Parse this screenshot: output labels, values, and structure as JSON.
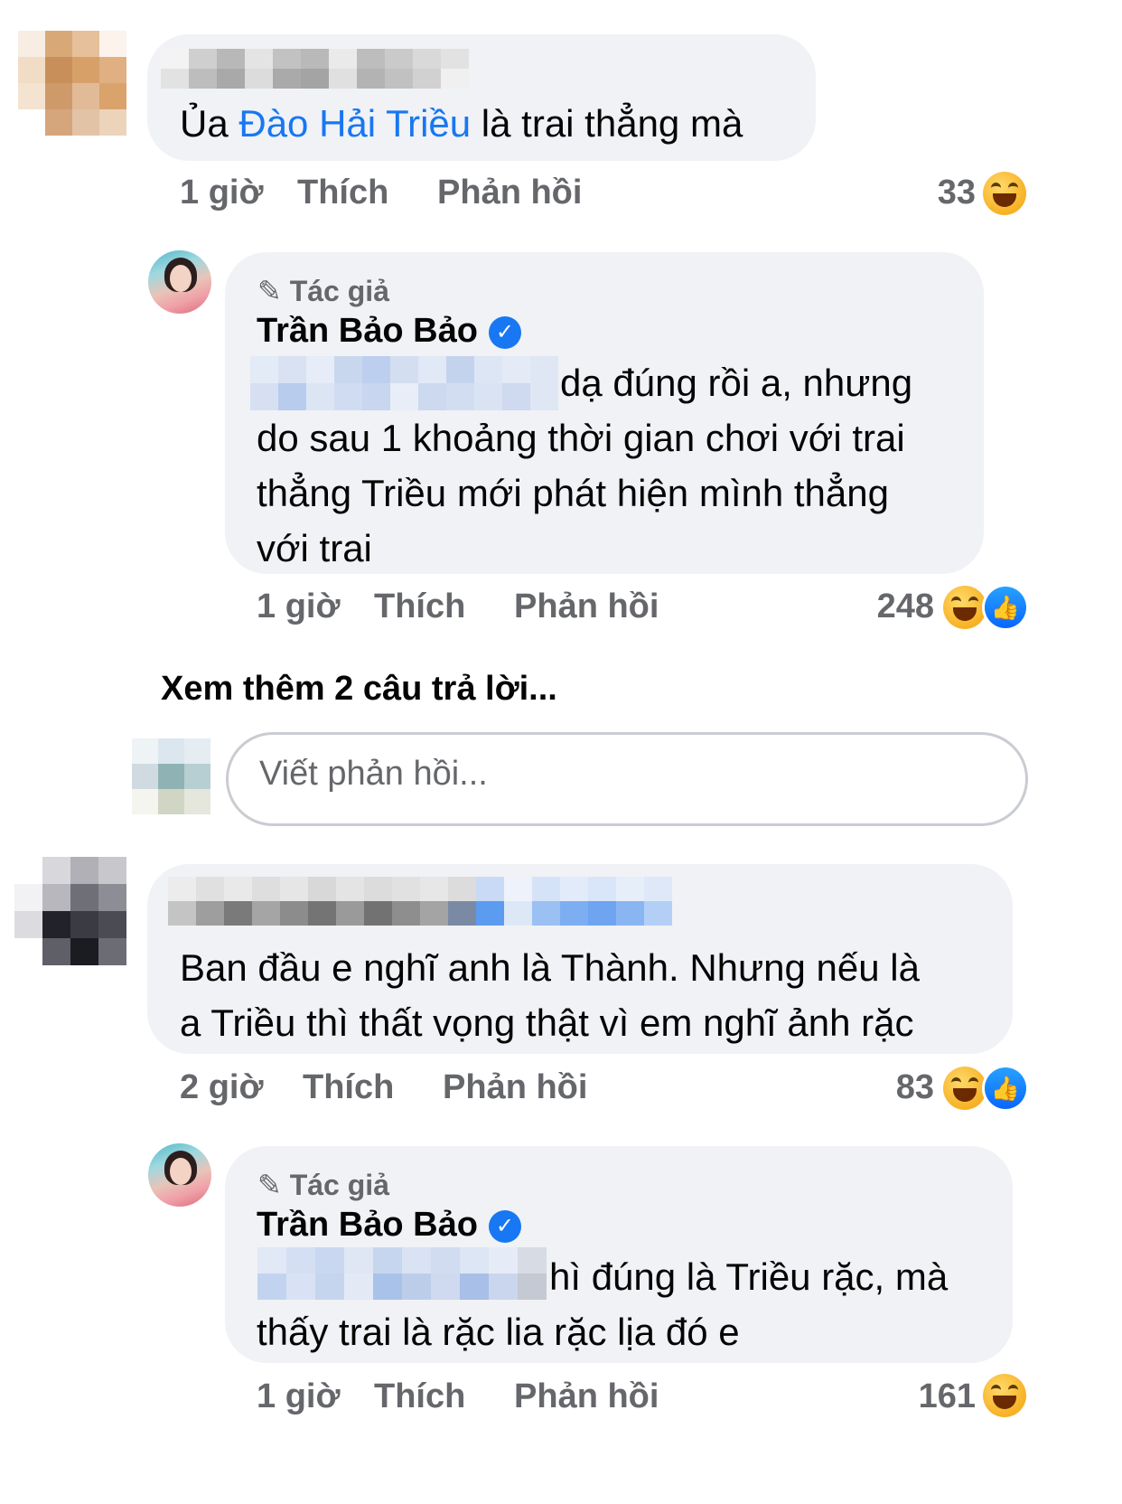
{
  "comments": [
    {
      "text_parts": [
        {
          "text": "Ủa ",
          "link": false
        },
        {
          "text": "Đào Hải Triều",
          "link": true
        },
        {
          "text": " là trai thẳng mà",
          "link": false
        }
      ],
      "time": "1 giờ",
      "like_label": "Thích",
      "reply_label": "Phản hồi",
      "reaction_count": "33",
      "reactions": [
        "haha-icon"
      ]
    },
    {
      "badge": "Tác giả",
      "name": "Trần Bảo Bảo",
      "lines": [
        "dạ đúng rồi a, nhưng",
        "do sau 1 khoảng thời gian chơi với trai",
        "thẳng Triều mới phát hiện mình thẳng",
        "với trai"
      ],
      "time": "1 giờ",
      "like_label": "Thích",
      "reply_label": "Phản hồi",
      "reaction_count": "248",
      "reactions": [
        "haha-icon",
        "like-icon"
      ]
    },
    {
      "lines": [
        "Ban đầu e nghĩ anh là Thành. Nhưng nếu là",
        "a Triều thì thất vọng thật vì em nghĩ ảnh rặc"
      ],
      "time": "2 giờ",
      "like_label": "Thích",
      "reply_label": "Phản hồi",
      "reaction_count": "83",
      "reactions": [
        "haha-icon",
        "like-icon"
      ]
    },
    {
      "badge": "Tác giả",
      "name": "Trần Bảo Bảo",
      "lines": [
        "hì đúng là Triều rặc, mà",
        "thấy trai là rặc lia rặc lịa đó e"
      ],
      "time": "1 giờ",
      "like_label": "Thích",
      "reply_label": "Phản hồi",
      "reaction_count": "161",
      "reactions": [
        "haha-icon"
      ]
    }
  ],
  "see_more": "Xem thêm 2 câu trả lời...",
  "reply_placeholder": "Viết phản hồi...",
  "colors": {
    "link": "#1877f2",
    "bubble": "#f0f2f5",
    "meta": "#65676b",
    "like_blue": "#0866ff",
    "haha_yellow": "#f7b125"
  }
}
